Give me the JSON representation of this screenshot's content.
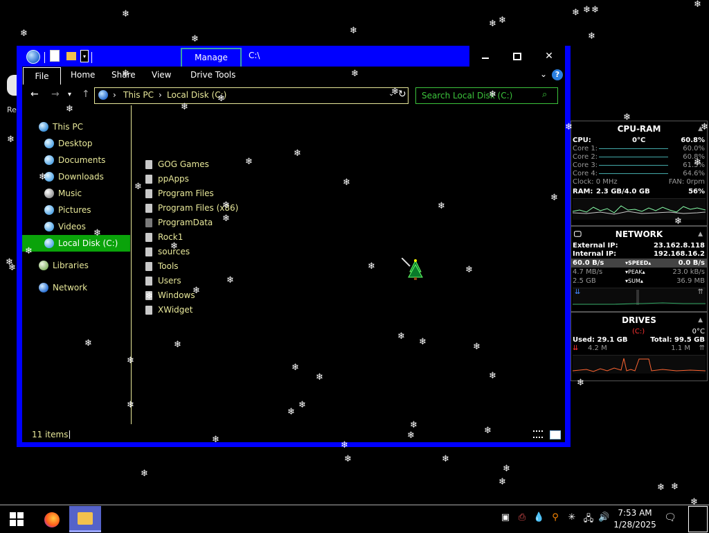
{
  "desktop": {
    "icon_label": "Rec"
  },
  "window": {
    "ribbon_context_tab": "Manage",
    "title": "C:\\",
    "menu": [
      "File",
      "Home",
      "Share",
      "View",
      "Drive Tools"
    ],
    "breadcrumb": [
      "This PC",
      "Local Disk (C:)"
    ],
    "search_placeholder": "Search Local Disk (C:)",
    "nav": [
      {
        "label": "This PC",
        "icon": "computer-icon"
      },
      {
        "label": "Desktop",
        "icon": "desktop-icon"
      },
      {
        "label": "Documents",
        "icon": "documents-icon"
      },
      {
        "label": "Downloads",
        "icon": "downloads-icon"
      },
      {
        "label": "Music",
        "icon": "music-icon"
      },
      {
        "label": "Pictures",
        "icon": "pictures-icon"
      },
      {
        "label": "Videos",
        "icon": "videos-icon"
      },
      {
        "label": "Local Disk (C:)",
        "icon": "drive-icon",
        "selected": true
      },
      {
        "label": "Libraries",
        "icon": "libraries-icon"
      },
      {
        "label": "Network",
        "icon": "network-icon"
      }
    ],
    "files": [
      "GOG Games",
      "ppApps",
      "Program Files",
      "Program Files (x86)",
      "ProgramData",
      "Rock1",
      "sources",
      "Tools",
      "Users",
      "Windows",
      "XWidget"
    ],
    "status": "11 items"
  },
  "gadgets": {
    "cpu": {
      "title": "CPU-RAM",
      "cpu_label": "CPU:",
      "temp": "0°C",
      "cpu_pct": "60.8%",
      "cores": [
        {
          "label": "Core 1:",
          "value": "60.0%"
        },
        {
          "label": "Core 2:",
          "value": "60.8%"
        },
        {
          "label": "Core 3:",
          "value": "61.5%"
        },
        {
          "label": "Core 4:",
          "value": "64.6%"
        }
      ],
      "clock": "Clock: 0 MHz",
      "fan": "FAN: 0rpm",
      "ram_label": "RAM:",
      "ram_value": "2.3 GB/4.0 GB",
      "ram_pct": "56%"
    },
    "network": {
      "title": "NETWORK",
      "ext_label": "External IP:",
      "ext_ip": "23.162.8.118",
      "int_label": "Internal IP:",
      "int_ip": "192.168.16.2",
      "speed_down": "60.0 B/s",
      "speed_label": "SPEED",
      "speed_up": "0.0 B/s",
      "peak_down": "4.7 MB/s",
      "peak_label": "PEAK",
      "peak_up": "23.0 kB/s",
      "sum_down": "2.5 GB",
      "sum_label": "SUM",
      "sum_up": "36.9 MB"
    },
    "drives": {
      "title": "DRIVES",
      "drive": "(C:)",
      "temp": "0°C",
      "used": "Used: 29.1 GB",
      "total": "Total: 99.5 GB",
      "read": "4.2 M",
      "write": "1.1 M"
    }
  },
  "taskbar": {
    "time": "7:53 AM",
    "date": "1/28/2025"
  }
}
